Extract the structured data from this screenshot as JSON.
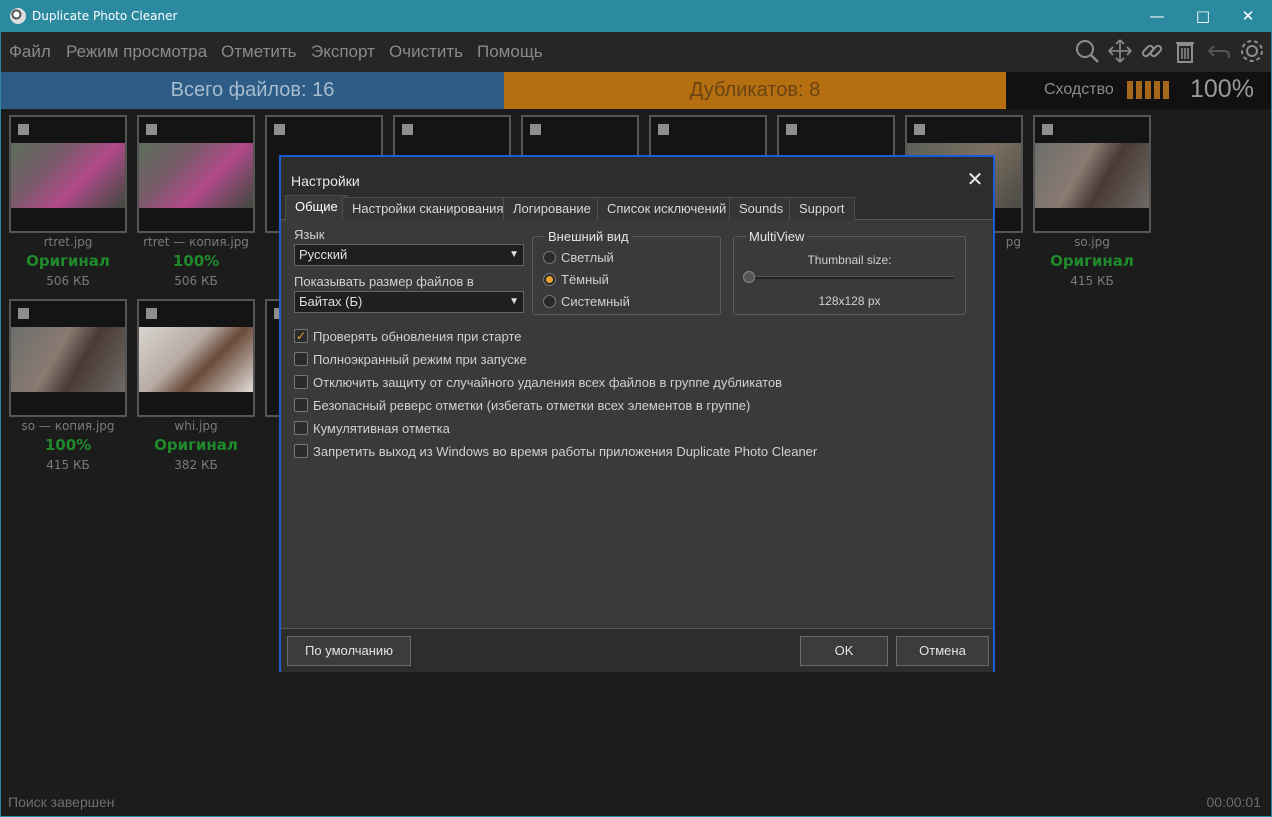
{
  "window": {
    "title": "Duplicate Photo Cleaner"
  },
  "menu": [
    "Файл",
    "Режим просмотра",
    "Отметить",
    "Экспорт",
    "Очистить",
    "Помощь"
  ],
  "summary": {
    "total": "Всего файлов: 16",
    "duplicates": "Дубликатов: 8",
    "similarity_label": "Сходство",
    "similarity_value": "100%"
  },
  "thumbnails": [
    {
      "name": "rtret.jpg",
      "status": "Оригинал",
      "size": "506 КБ"
    },
    {
      "name": "rtret — копия.jpg",
      "status": "100%",
      "size": "506 КБ"
    },
    {
      "name": "",
      "status": "",
      "size": ""
    },
    {
      "name": "",
      "status": "",
      "size": ""
    },
    {
      "name": "",
      "status": "",
      "size": ""
    },
    {
      "name": "",
      "status": "",
      "size": ""
    },
    {
      "name": "",
      "status": "",
      "size": ""
    },
    {
      "name": "pg",
      "status": "",
      "size": ""
    },
    {
      "name": "so.jpg",
      "status": "Оригинал",
      "size": "415 КБ"
    },
    {
      "name": "so — копия.jpg",
      "status": "100%",
      "size": "415 КБ"
    },
    {
      "name": "whi.jpg",
      "status": "Оригинал",
      "size": "382 КБ"
    }
  ],
  "status": {
    "text": "Поиск завершен",
    "timer": "00:00:01"
  },
  "dialog": {
    "title": "Настройки",
    "tabs": [
      "Общие",
      "Настройки сканирования",
      "Логирование",
      "Список исключений",
      "Sounds",
      "Support"
    ],
    "language_label": "Язык",
    "language_value": "Русский",
    "size_label": "Показывать размер файлов в",
    "size_value": "Байтах (Б)",
    "appearance": {
      "title": "Внешний вид",
      "options": [
        "Светлый",
        "Тёмный",
        "Системный"
      ],
      "selected": "Тёмный"
    },
    "multiview": {
      "title": "MultiView",
      "thumb_label": "Thumbnail size:",
      "thumb_value": "128x128 px"
    },
    "checkboxes": [
      {
        "label": "Проверять обновления при старте",
        "checked": true
      },
      {
        "label": "Полноэкранный режим при запуске",
        "checked": false
      },
      {
        "label": "Отключить защиту от случайного удаления всех файлов в группе дубликатов",
        "checked": false
      },
      {
        "label": "Безопасный реверс отметки (избегать отметки всех элементов в группе)",
        "checked": false
      },
      {
        "label": "Кумулятивная отметка",
        "checked": false
      },
      {
        "label": "Запретить выход из Windows во время работы приложения Duplicate Photo Cleaner",
        "checked": false
      }
    ],
    "buttons": {
      "defaults": "По умолчанию",
      "ok": "OK",
      "cancel": "Отмена"
    }
  },
  "colors": {
    "titlebar": "#2b8aa0",
    "total": "#2d5d86",
    "duplicates": "#b56e10",
    "accent": "#e8a331",
    "dialog_border": "#1d5bd6",
    "status_green": "#1f8a2a"
  }
}
